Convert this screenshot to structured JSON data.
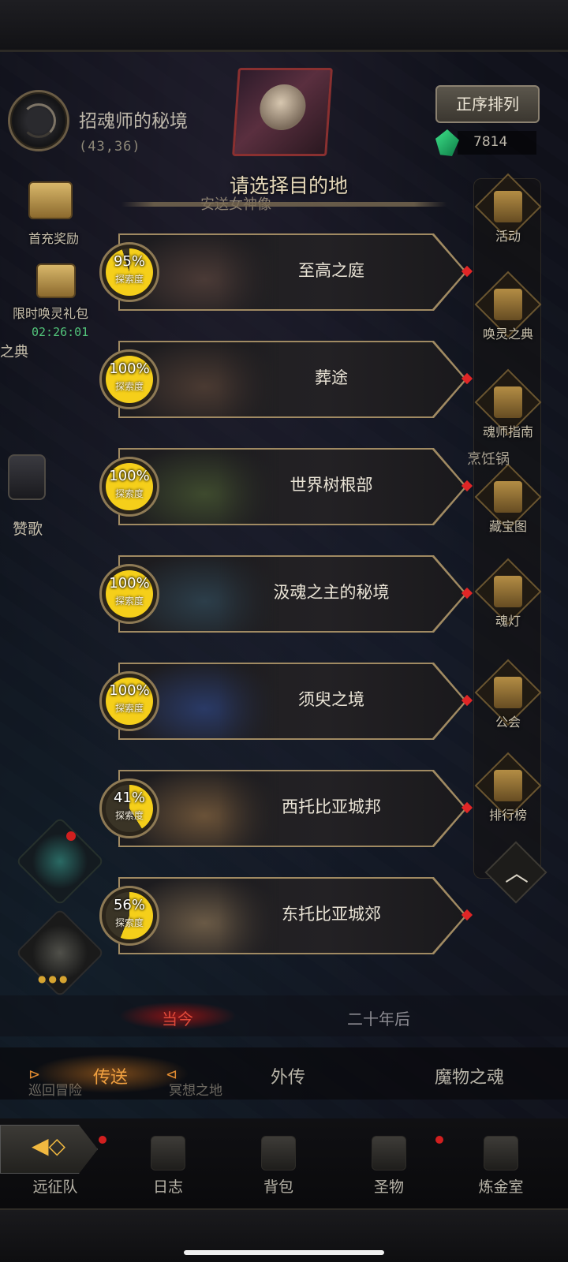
{
  "location": {
    "name": "招魂师的秘境",
    "coords": "(43,36)"
  },
  "sort_button": "正序排列",
  "currency": {
    "amount": "7814"
  },
  "dialog": {
    "title": "请选择目的地",
    "subtitle": "安送女神像"
  },
  "left_menu": {
    "first_charge": "首充奖励",
    "limited_pack": "限时唤灵礼包",
    "timer": "02:26:01",
    "cut_label": "之典",
    "hymn": "赞歌"
  },
  "right_menu": {
    "items": [
      "活动",
      "唤灵之典",
      "魂师指南",
      "藏宝图",
      "魂灯",
      "公会",
      "排行榜"
    ],
    "pot": "烹饪锅"
  },
  "destinations": [
    {
      "name": "至高之庭",
      "progress": "95%",
      "progress_value": 95,
      "label": "探索度",
      "art_color": "#4a3a36"
    },
    {
      "name": "葬途",
      "progress": "100%",
      "progress_value": 100,
      "label": "探索度",
      "art_color": "#4a3a32"
    },
    {
      "name": "世界树根部",
      "progress": "100%",
      "progress_value": 100,
      "label": "探索度",
      "art_color": "#3e4a2e"
    },
    {
      "name": "汲魂之主的秘境",
      "progress": "100%",
      "progress_value": 100,
      "label": "探索度",
      "art_color": "#2c3e4a"
    },
    {
      "name": "须臾之境",
      "progress": "100%",
      "progress_value": 100,
      "label": "探索度",
      "art_color": "#2a3a66"
    },
    {
      "name": "西托比亚城邦",
      "progress": "41%",
      "progress_value": 41,
      "label": "探索度",
      "art_color": "#6a5238"
    },
    {
      "name": "东托比亚城郊",
      "progress": "56%",
      "progress_value": 56,
      "label": "探索度",
      "art_color": "#6a5a46"
    }
  ],
  "era_tabs": {
    "current": "当今",
    "future": "二十年后"
  },
  "tabs": {
    "teleport": "传送",
    "lore": "外传",
    "souls": "魔物之魂"
  },
  "ghost_labels": {
    "left": "巡回冒险",
    "mid": "冥想之地"
  },
  "nav": [
    "远征队",
    "日志",
    "背包",
    "圣物",
    "炼金室"
  ],
  "colors": {
    "accent": "#f0a040",
    "progress_fill": "#f5cf1a",
    "alert": "#e02626",
    "timer": "#52c47a"
  }
}
